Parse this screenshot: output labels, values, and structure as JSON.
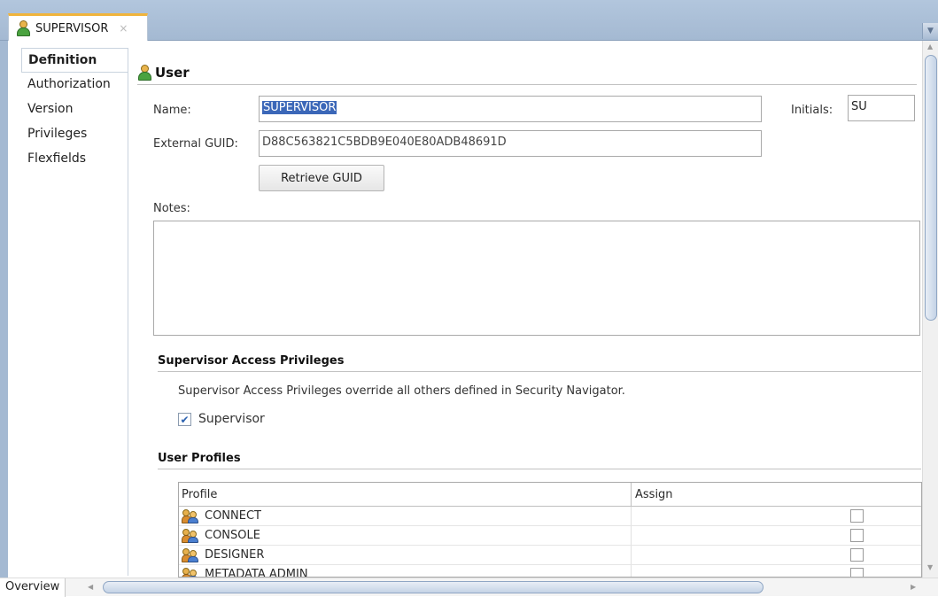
{
  "tab": {
    "title": "SUPERVISOR",
    "close": "×"
  },
  "nav": {
    "items": [
      {
        "label": "Definition"
      },
      {
        "label": "Authorization"
      },
      {
        "label": "Version"
      },
      {
        "label": "Privileges"
      },
      {
        "label": "Flexfields"
      }
    ]
  },
  "section": {
    "title": "User"
  },
  "form": {
    "name_label": "Name:",
    "name_value": "SUPERVISOR",
    "initials_label": "Initials:",
    "initials_value": "SU",
    "guid_label": "External GUID:",
    "guid_value": "D88C563821C5BDB9E040E80ADB48691D",
    "retrieve_button": "Retrieve GUID",
    "notes_label": "Notes:",
    "notes_value": ""
  },
  "access": {
    "header": "Supervisor Access Privileges",
    "description": "Supervisor Access Privileges override all others defined in Security Navigator.",
    "checkbox_label": "Supervisor",
    "checked": true
  },
  "profiles": {
    "header": "User Profiles",
    "columns": [
      "Profile",
      "Assign"
    ],
    "rows": [
      {
        "name": "CONNECT",
        "assigned": false
      },
      {
        "name": "CONSOLE",
        "assigned": false
      },
      {
        "name": "DESIGNER",
        "assigned": false
      },
      {
        "name": "METADATA ADMIN",
        "assigned": false
      }
    ]
  },
  "bottom": {
    "overview_tab": "Overview"
  },
  "colors": {
    "tab_accent": "#f0b43c",
    "checkbox_check": "#2b62b0",
    "selection": "#3b67b8"
  }
}
